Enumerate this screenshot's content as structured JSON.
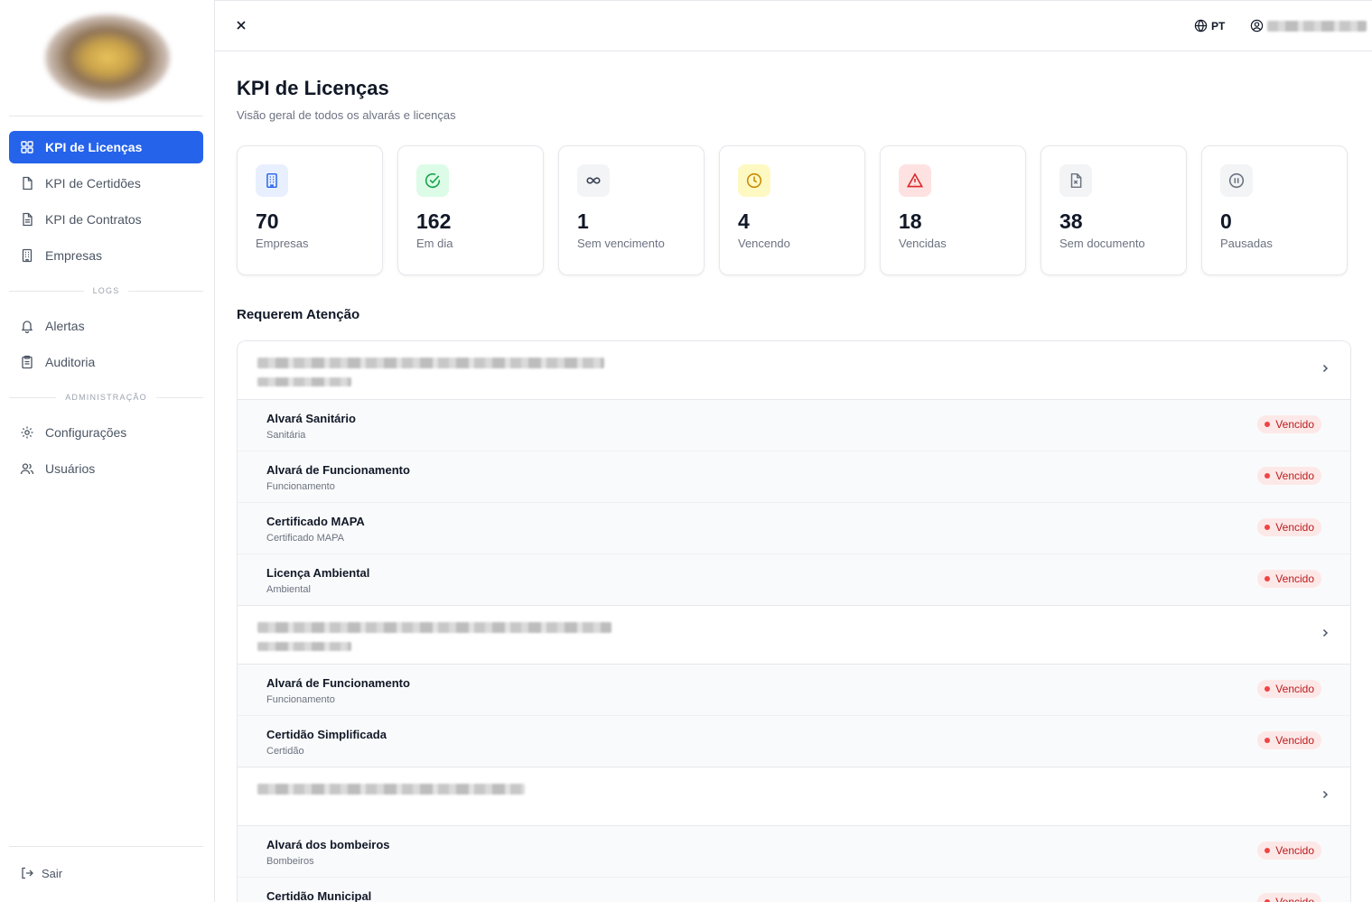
{
  "sidebar": {
    "nav": [
      {
        "label": "KPI de Licenças",
        "icon": "grid-icon",
        "active": true
      },
      {
        "label": "KPI de Certidões",
        "icon": "file-icon"
      },
      {
        "label": "KPI de Contratos",
        "icon": "file-text-icon"
      },
      {
        "label": "Empresas",
        "icon": "building-icon"
      }
    ],
    "logs_label": "LOGS",
    "logs": [
      {
        "label": "Alertas",
        "icon": "bell-icon"
      },
      {
        "label": "Auditoria",
        "icon": "clipboard-icon"
      }
    ],
    "admin_label": "ADMINISTRAÇÃO",
    "admin": [
      {
        "label": "Configurações",
        "icon": "gear-icon"
      },
      {
        "label": "Usuários",
        "icon": "users-icon"
      }
    ],
    "logout_label": "Sair"
  },
  "topbar": {
    "language": "PT"
  },
  "page": {
    "title": "KPI de Licenças",
    "subtitle": "Visão geral de todos os alvarás e licenças"
  },
  "kpis": [
    {
      "value": "70",
      "label": "Empresas",
      "icon": "building-icon",
      "bg": "#e8efff",
      "fg": "#2563eb"
    },
    {
      "value": "162",
      "label": "Em dia",
      "icon": "check-circle-icon",
      "bg": "#dcfce7",
      "fg": "#16a34a"
    },
    {
      "value": "1",
      "label": "Sem vencimento",
      "icon": "infinity-icon",
      "bg": "#f3f4f6",
      "fg": "#374151"
    },
    {
      "value": "4",
      "label": "Vencendo",
      "icon": "clock-icon",
      "bg": "#fef9c3",
      "fg": "#ca8a04"
    },
    {
      "value": "18",
      "label": "Vencidas",
      "icon": "alert-triangle-icon",
      "bg": "#fee2e2",
      "fg": "#dc2626"
    },
    {
      "value": "38",
      "label": "Sem documento",
      "icon": "file-x-icon",
      "bg": "#f3f4f6",
      "fg": "#6b7280"
    },
    {
      "value": "0",
      "label": "Pausadas",
      "icon": "pause-circle-icon",
      "bg": "#f3f4f6",
      "fg": "#6b7280"
    }
  ],
  "attention": {
    "title": "Requerem Atenção",
    "status_label": "Vencido",
    "groups": [
      {
        "licenses": [
          {
            "name": "Alvará Sanitário",
            "type": "Sanitária"
          },
          {
            "name": "Alvará de Funcionamento",
            "type": "Funcionamento"
          },
          {
            "name": "Certificado MAPA",
            "type": "Certificado MAPA"
          },
          {
            "name": "Licença Ambiental",
            "type": "Ambiental"
          }
        ]
      },
      {
        "licenses": [
          {
            "name": "Alvará de Funcionamento",
            "type": "Funcionamento"
          },
          {
            "name": "Certidão Simplificada",
            "type": "Certidão"
          }
        ]
      },
      {
        "licenses": [
          {
            "name": "Alvará dos bombeiros",
            "type": "Bombeiros"
          },
          {
            "name": "Certidão Municipal",
            "type": ""
          }
        ]
      }
    ]
  },
  "colors": {
    "accent": "#2563eb",
    "danger_bg": "#fde8e8",
    "danger_fg": "#b91c1c"
  }
}
